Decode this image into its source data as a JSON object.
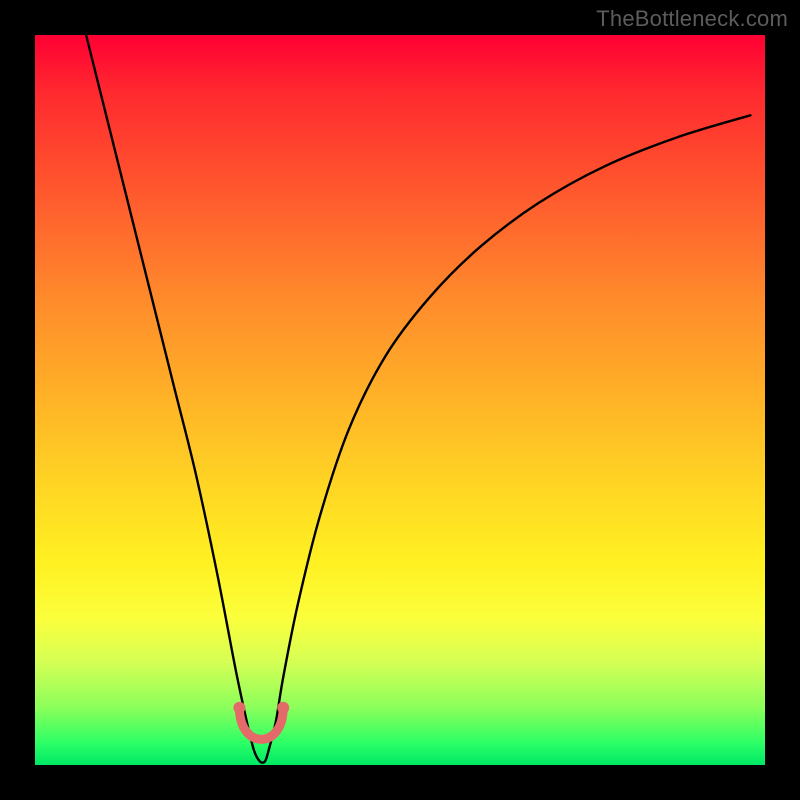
{
  "watermark": "TheBottleneck.com",
  "colors": {
    "background": "#000000",
    "gradient_top": "#ff0033",
    "gradient_bottom": "#00e865",
    "curve": "#000000",
    "marker": "#e46a6a",
    "watermark_text": "#5c5c5c"
  },
  "chart_data": {
    "type": "line",
    "title": "",
    "xlabel": "",
    "ylabel": "",
    "xlim": [
      0,
      100
    ],
    "ylim": [
      0,
      100
    ],
    "series": [
      {
        "name": "bottleneck-curve",
        "x": [
          7,
          10,
          13,
          16,
          19,
          22,
          25,
          27.5,
          29,
          30,
          30.8,
          31.5,
          32,
          33,
          34,
          36,
          39,
          43,
          48,
          54,
          61,
          69,
          78,
          88,
          98
        ],
        "values": [
          100,
          88,
          76,
          64,
          52,
          40,
          26,
          13,
          6,
          2,
          0.5,
          0.5,
          2,
          6,
          12,
          22,
          34,
          46,
          56,
          64,
          71,
          77,
          82,
          86,
          89
        ]
      }
    ],
    "marker": {
      "name": "dip-marker-U",
      "x_center": 31,
      "y_center": 4,
      "approx_width": 6
    },
    "grid": false,
    "legend": false,
    "notes": "Background is a vertical rainbow gradient (red→green). Curve is a sharp V/U near x≈31. Values are estimates read from an unlabeled axis with implied 0–100 range."
  }
}
